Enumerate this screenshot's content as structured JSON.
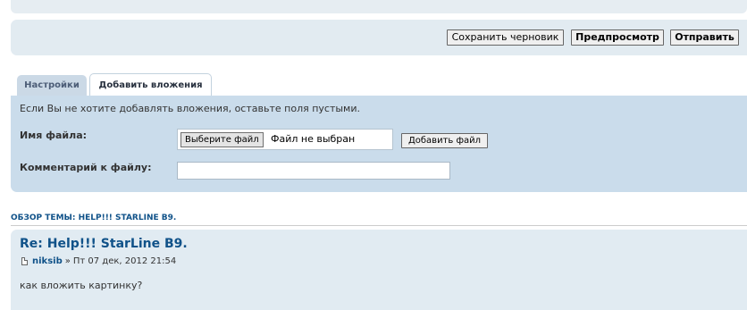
{
  "actions": {
    "save_draft": "Сохранить черновик",
    "preview": "Предпросмотр",
    "submit": "Отправить"
  },
  "tabs": [
    {
      "label": "Настройки",
      "active": false
    },
    {
      "label": "Добавить вложения",
      "active": true
    }
  ],
  "attachments": {
    "info": "Если Вы не хотите добавлять вложения, оставьте поля пустыми.",
    "filename_label": "Имя файла:",
    "choose_button": "Выберите файл",
    "no_file": "Файл не выбран",
    "add_file_button": "Добавить файл",
    "comment_label": "Комментарий к файлу:",
    "comment_value": ""
  },
  "review": {
    "title": "ОБЗОР ТЕМЫ: HELP!!! STARLINE B9."
  },
  "post": {
    "title": "Re: Help!!! StarLine B9.",
    "author": "niksib",
    "separator": "»",
    "date": "Пт 07 дек, 2012 21:54",
    "body": "как вложить картинку?"
  },
  "colors": {
    "link": "#105289",
    "panel": "#cadceb",
    "post_bg": "#e1ebf2"
  }
}
